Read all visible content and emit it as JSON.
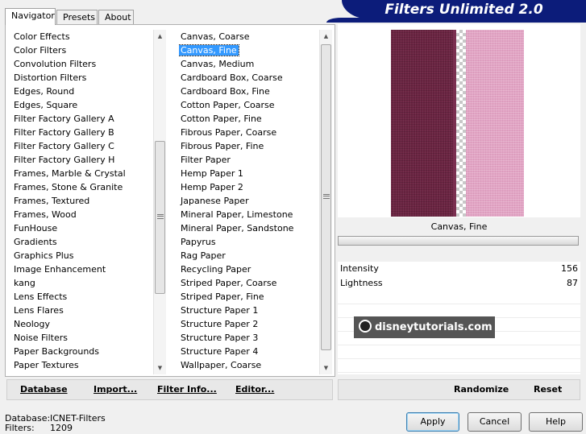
{
  "window": {
    "banner": "Filters Unlimited 2.0"
  },
  "tabs": [
    {
      "label": "Navigator"
    },
    {
      "label": "Presets"
    },
    {
      "label": "About"
    }
  ],
  "categories": [
    {
      "label": "Color Effects"
    },
    {
      "label": "Color Filters"
    },
    {
      "label": "Convolution Filters"
    },
    {
      "label": "Distortion Filters"
    },
    {
      "label": "Edges, Round"
    },
    {
      "label": "Edges, Square"
    },
    {
      "label": "Filter Factory Gallery A"
    },
    {
      "label": "Filter Factory Gallery B"
    },
    {
      "label": "Filter Factory Gallery C"
    },
    {
      "label": "Filter Factory Gallery H"
    },
    {
      "label": "Frames, Marble & Crystal"
    },
    {
      "label": "Frames, Stone & Granite"
    },
    {
      "label": "Frames, Textured"
    },
    {
      "label": "Frames, Wood"
    },
    {
      "label": "FunHouse"
    },
    {
      "label": "Gradients"
    },
    {
      "label": "Graphics Plus"
    },
    {
      "label": "Image Enhancement"
    },
    {
      "label": "kang"
    },
    {
      "label": "Lens Effects"
    },
    {
      "label": "Lens Flares"
    },
    {
      "label": "Neology"
    },
    {
      "label": "Noise Filters"
    },
    {
      "label": "Paper Backgrounds"
    },
    {
      "label": "Paper Textures"
    }
  ],
  "filters": [
    {
      "label": "Canvas, Coarse"
    },
    {
      "label": "Canvas, Fine",
      "selected": true
    },
    {
      "label": "Canvas, Medium"
    },
    {
      "label": "Cardboard Box, Coarse"
    },
    {
      "label": "Cardboard Box, Fine"
    },
    {
      "label": "Cotton Paper, Coarse"
    },
    {
      "label": "Cotton Paper, Fine"
    },
    {
      "label": "Fibrous Paper, Coarse"
    },
    {
      "label": "Fibrous Paper, Fine"
    },
    {
      "label": "Filter Paper"
    },
    {
      "label": "Hemp Paper 1"
    },
    {
      "label": "Hemp Paper 2"
    },
    {
      "label": "Japanese Paper"
    },
    {
      "label": "Mineral Paper, Limestone"
    },
    {
      "label": "Mineral Paper, Sandstone"
    },
    {
      "label": "Papyrus"
    },
    {
      "label": "Rag Paper"
    },
    {
      "label": "Recycling Paper"
    },
    {
      "label": "Striped Paper, Coarse"
    },
    {
      "label": "Striped Paper, Fine"
    },
    {
      "label": "Structure Paper 1"
    },
    {
      "label": "Structure Paper 2"
    },
    {
      "label": "Structure Paper 3"
    },
    {
      "label": "Structure Paper 4"
    },
    {
      "label": "Wallpaper, Coarse"
    }
  ],
  "left_buttons": {
    "database": "Database",
    "import": "Import...",
    "filter_info": "Filter Info...",
    "editor": "Editor..."
  },
  "preview": {
    "filter_name": "Canvas, Fine",
    "watermark": "disneytutorials.com"
  },
  "params": [
    {
      "label": "Intensity",
      "value": "156"
    },
    {
      "label": "Lightness",
      "value": "87"
    }
  ],
  "right_buttons": {
    "randomize": "Randomize",
    "reset": "Reset"
  },
  "status": {
    "database_label": "Database:",
    "database_value": "ICNET-Filters",
    "filters_label": "Filters:",
    "filters_value": "1209"
  },
  "dialog_buttons": {
    "apply": "Apply",
    "cancel": "Cancel",
    "help": "Help"
  },
  "colors": {
    "banner": "#0c1c7a",
    "selection": "#3399ff",
    "preview_dark": "#6b2442",
    "preview_pink": "#e2a4c4"
  }
}
